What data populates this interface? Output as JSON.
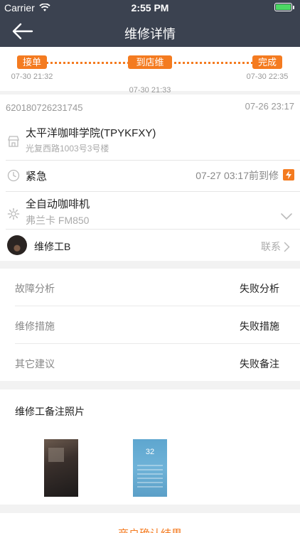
{
  "status_bar": {
    "carrier": "Carrier",
    "time": "2:55 PM",
    "battery_level": 1.0,
    "battery_color": "#4cd964"
  },
  "nav": {
    "title": "维修详情"
  },
  "progress": {
    "accent": "#f47b20",
    "steps": [
      {
        "label": "接单",
        "time": "07-30 21:32"
      },
      {
        "label": "到店维修",
        "time": "07-30 21:33"
      },
      {
        "label": "完成",
        "time": "07-30 22:35"
      }
    ]
  },
  "order": {
    "number": "620180726231745",
    "time": "07-26 23:17"
  },
  "shop": {
    "name": "太平洋咖啡学院(TPYKFXY)",
    "address": "光复西路1003号3号楼",
    "icon": "shop-icon"
  },
  "urgency": {
    "label": "紧急",
    "due": "07-27 03:17前到修",
    "icon": "clock-icon",
    "badge_icon": "lightning-icon"
  },
  "device": {
    "name": "全自动咖啡机",
    "model": "弗兰卡 FM850",
    "icon": "gear-icon"
  },
  "worker": {
    "name": "维修工B",
    "contact_label": "联系"
  },
  "analysis": [
    {
      "key": "故障分析",
      "value": "失败分析"
    },
    {
      "key": "维修措施",
      "value": "失败措施"
    },
    {
      "key": "其它建议",
      "value": "失败备注"
    }
  ],
  "photos": {
    "title": "维修工备注照片",
    "photo2_temp": "32"
  },
  "confirm": {
    "label": "商户确认结果"
  }
}
